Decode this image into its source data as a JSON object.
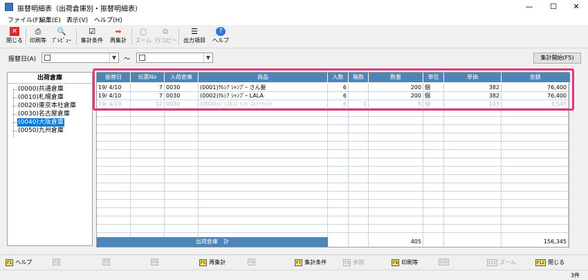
{
  "window": {
    "title": "振替明細表（出荷倉庫別・振替明細表）"
  },
  "menu": [
    "ファイル(F)",
    "編集(E)",
    "表示(V)",
    "ヘルプ(H)"
  ],
  "toolbar": {
    "close": "閉じる",
    "print": "印刷等",
    "preview": "ﾌﾟﾚﾋﾞｭｰ",
    "conditions": "集計条件",
    "recalc": "再集計",
    "zoom": "ズーム",
    "rowcopy": "行コピー",
    "output": "出力項目",
    "help": "ヘルプ"
  },
  "filter": {
    "label": "振替日(A)",
    "tilde": "〜",
    "start_button": "集計開始(F5)"
  },
  "warehouses": {
    "header": "出荷倉庫",
    "items": [
      "(0000)共通倉庫",
      "(0010)札幌倉庫",
      "(0020)東京本社倉庫",
      "(0030)名古屋倉庫",
      "(0040)大阪倉庫",
      "(0050)九州倉庫"
    ],
    "selected_index": 4
  },
  "grid": {
    "headers": [
      "振替日",
      "伝票No",
      "入荷倉庫",
      "商品",
      "入数",
      "箱数",
      "数量",
      "単位",
      "単価",
      "金額"
    ],
    "rows": [
      [
        "19/ 4/10",
        "7",
        "0030",
        "(0001)ｸﾙｼｱ ｼｬﾝﾌﾟｰ さん髪",
        "6",
        "",
        "200",
        "個",
        "382",
        "76,400"
      ],
      [
        "19/ 4/10",
        "7",
        "0030",
        "(0002)ｸﾙｼｱ ｼｬﾝﾌﾟｰ LALA",
        "6",
        "",
        "200",
        "個",
        "382",
        "76,400"
      ],
      [
        "19/ 4/10",
        "12",
        "0030",
        "(0020)ﾊﾟｼｽﾀﾝｽ ｲﾝﾊﾞｽﾄﾘｰﾄﾒﾝﾄ",
        "6",
        "1",
        "5",
        "個",
        "103",
        "3,545"
      ]
    ],
    "total": {
      "label": "出荷倉庫　計",
      "quantity": "405",
      "amount": "156,345"
    }
  },
  "fkeys": [
    {
      "key": "F1",
      "label": "ヘルプ",
      "enabled": true
    },
    {
      "key": "F2",
      "label": "",
      "enabled": false
    },
    {
      "key": "F3",
      "label": "",
      "enabled": false
    },
    {
      "key": "F4",
      "label": "",
      "enabled": false
    },
    {
      "key": "F5",
      "label": "再集計",
      "enabled": true
    },
    {
      "key": "F6",
      "label": "",
      "enabled": false
    },
    {
      "key": "F7",
      "label": "集計条件",
      "enabled": true
    },
    {
      "key": "F8",
      "label": "参照",
      "enabled": false
    },
    {
      "key": "F9",
      "label": "印刷等",
      "enabled": true
    },
    {
      "key": "F10",
      "label": "",
      "enabled": false
    },
    {
      "key": "F11",
      "label": "ズーム",
      "enabled": false
    },
    {
      "key": "F12",
      "label": "閉じる",
      "enabled": true
    }
  ],
  "status": {
    "count": "3件"
  }
}
